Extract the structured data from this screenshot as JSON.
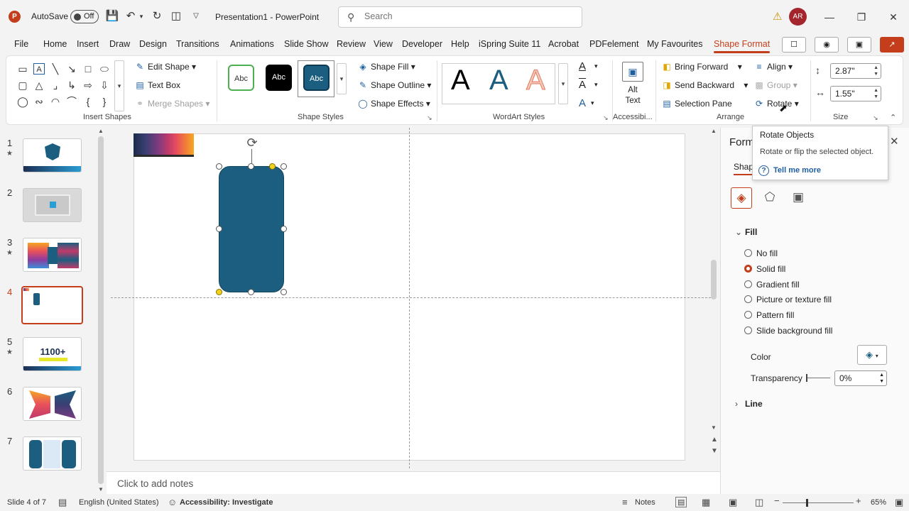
{
  "titlebar": {
    "logo": "P",
    "autosave_label": "AutoSave",
    "autosave_state": "Off",
    "doc_title": "Presentation1 - PowerPoint",
    "search_placeholder": "Search",
    "avatar_initials": "AR"
  },
  "menu": {
    "tabs": [
      "File",
      "Home",
      "Insert",
      "Draw",
      "Design",
      "Transitions",
      "Animations",
      "Slide Show",
      "Review",
      "View",
      "Developer",
      "Help",
      "iSpring Suite 11",
      "Acrobat",
      "PDFelement",
      "My Favourites",
      "Shape Format"
    ],
    "active": "Shape Format"
  },
  "ribbon": {
    "insert_shapes": {
      "label": "Insert Shapes",
      "edit_shape": "Edit Shape",
      "text_box": "Text Box",
      "merge_shapes": "Merge Shapes"
    },
    "shape_styles": {
      "label": "Shape Styles",
      "thumb_text": "Abc",
      "shape_fill": "Shape Fill",
      "shape_outline": "Shape Outline",
      "shape_effects": "Shape Effects"
    },
    "wordart": {
      "label": "WordArt Styles",
      "letter": "A"
    },
    "accessibility": {
      "label": "Accessibi...",
      "alt_text_line1": "Alt",
      "alt_text_line2": "Text"
    },
    "arrange": {
      "label": "Arrange",
      "bring_forward": "Bring Forward",
      "send_backward": "Send Backward",
      "selection_pane": "Selection Pane",
      "align": "Align",
      "group": "Group",
      "rotate": "Rotate"
    },
    "size": {
      "label": "Size",
      "height": "2.87\"",
      "width": "1.55\""
    }
  },
  "thumbnails": {
    "numbers": [
      "1",
      "2",
      "3",
      "4",
      "5",
      "6",
      "7"
    ],
    "selected": 4,
    "slide5_text": "1100+"
  },
  "notes": {
    "placeholder": "Click to add notes"
  },
  "format_pane": {
    "title": "Form",
    "tab": "Shap",
    "fill_section": "Fill",
    "fill_options": [
      "No fill",
      "Solid fill",
      "Gradient fill",
      "Picture or texture fill",
      "Pattern fill",
      "Slide background fill"
    ],
    "fill_selected": "Solid fill",
    "color_label": "Color",
    "transparency_label": "Transparency",
    "transparency_value": "0%",
    "line_section": "Line"
  },
  "tooltip": {
    "title": "Rotate Objects",
    "description": "Rotate or flip the selected object.",
    "more": "Tell me more"
  },
  "statusbar": {
    "slide_info": "Slide 4 of 7",
    "language": "English (United States)",
    "accessibility": "Accessibility: Investigate",
    "notes": "Notes",
    "zoom": "65%"
  },
  "colors": {
    "accent": "#c43e1c",
    "shape_fill": "#1b5e80",
    "link": "#1e5f9f"
  }
}
